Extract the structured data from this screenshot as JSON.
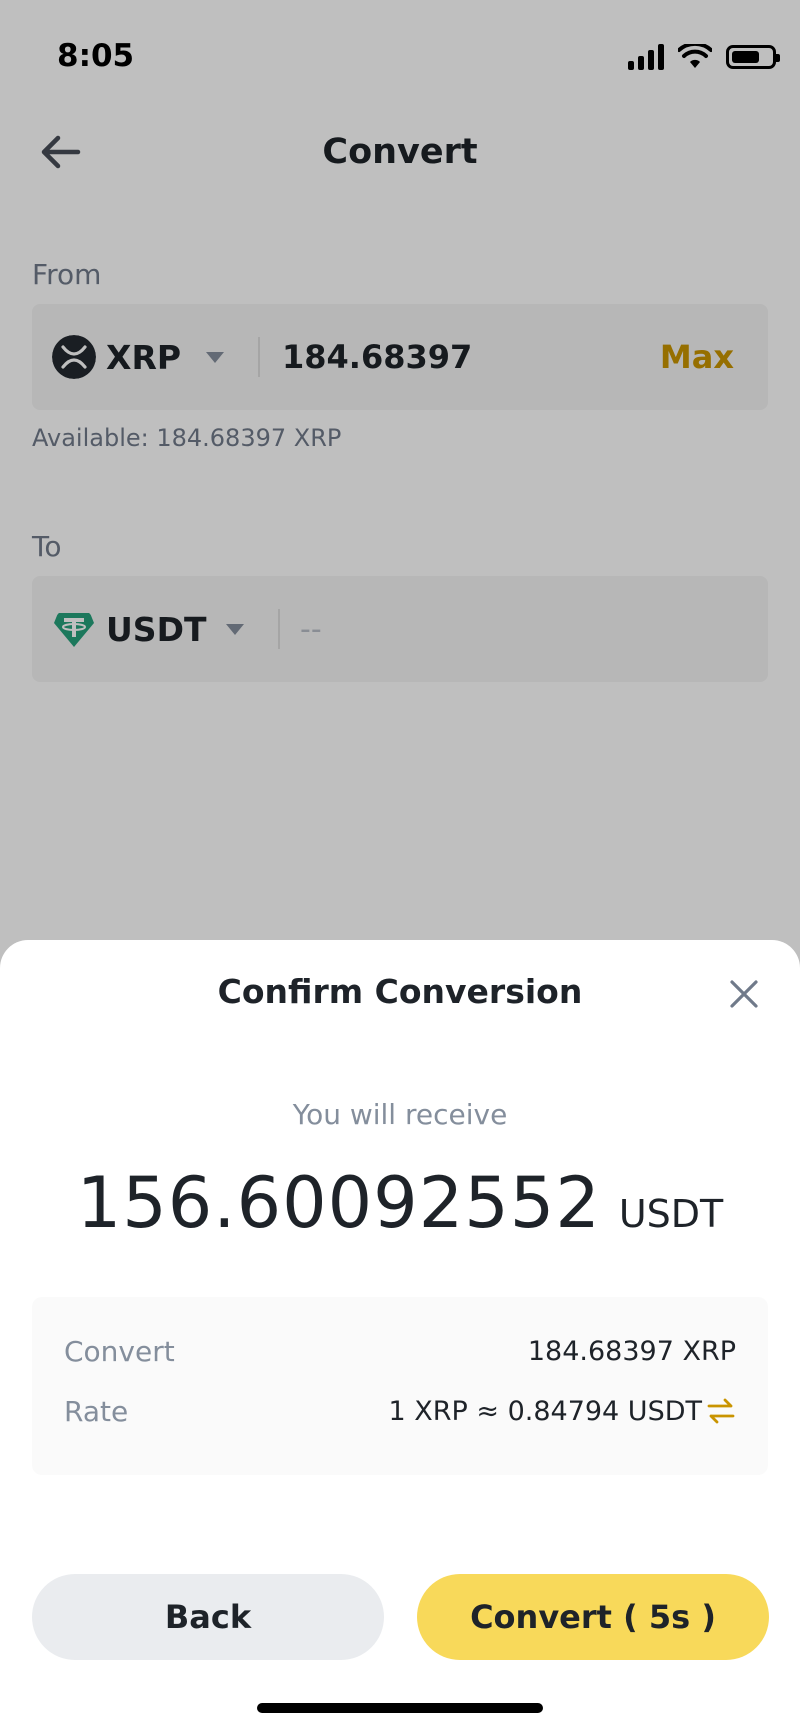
{
  "status_bar": {
    "time": "8:05"
  },
  "header": {
    "title": "Convert"
  },
  "from": {
    "label": "From",
    "coin": "XRP",
    "amount": "184.68397",
    "max_label": "Max",
    "available": "Available: 184.68397 XRP"
  },
  "to": {
    "label": "To",
    "coin": "USDT",
    "amount_placeholder": "--"
  },
  "sheet": {
    "title": "Confirm Conversion",
    "receive_label": "You will receive",
    "receive_amount": "156.60092552",
    "receive_unit": "USDT",
    "details": [
      {
        "key": "Convert",
        "value": "184.68397 XRP"
      },
      {
        "key": "Rate",
        "value": "1 XRP ≈ 0.84794 USDT"
      }
    ],
    "back_label": "Back",
    "convert_label": "Convert ( 5s )"
  },
  "colors": {
    "accent_gold": "#c99400",
    "button_yellow": "#f8d95a",
    "tether_green": "#26a17b"
  }
}
